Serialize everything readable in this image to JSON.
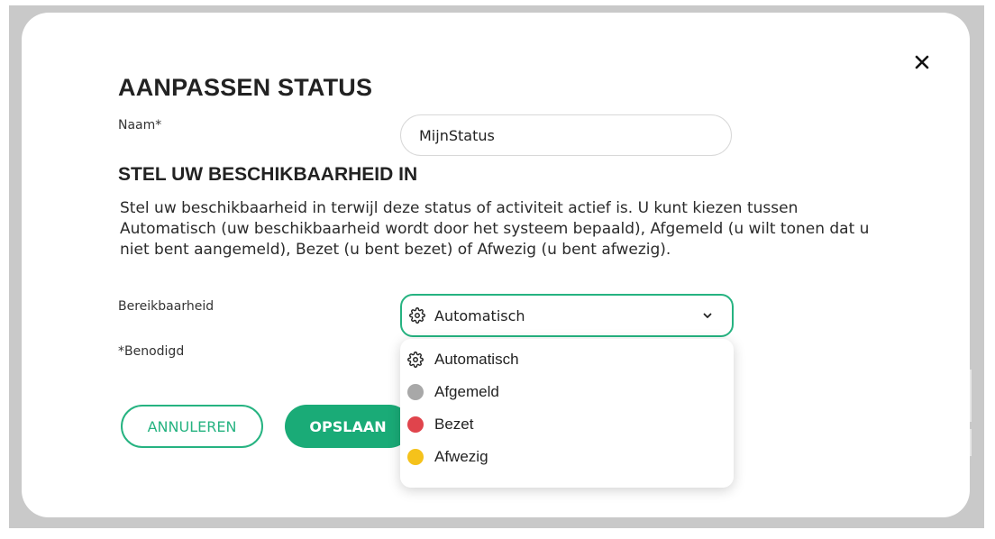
{
  "modal": {
    "title": "AANPASSEN STATUS",
    "close_icon": "close-icon"
  },
  "form": {
    "name_label": "Naam*",
    "name_value": "MijnStatus",
    "section_title": "STEL UW BESCHIKBAARHEID IN",
    "description": "Stel uw beschikbaarheid in terwijl deze status of activiteit actief is. U kunt kiezen tussen Automatisch (uw beschikbaarheid wordt door het systeem bepaald), Afgemeld (u wilt tonen dat u niet bent aangemeld), Bezet (u bent bezet) of Afwezig (u bent afwezig).",
    "availability_label": "Bereikbaarheid",
    "required_note": "*Benodigd"
  },
  "availability_select": {
    "selected": "Automatisch",
    "selected_icon": "gear-icon",
    "options": [
      {
        "label": "Automatisch",
        "icon": "gear-icon"
      },
      {
        "label": "Afgemeld",
        "color": "#a8a8a8"
      },
      {
        "label": "Bezet",
        "color": "#e0444c"
      },
      {
        "label": "Afwezig",
        "color": "#f5c21b"
      }
    ]
  },
  "buttons": {
    "cancel": "ANNULEREN",
    "save": "OPSLAAN"
  },
  "colors": {
    "accent": "#26b381",
    "primary_button": "#1aab77"
  }
}
